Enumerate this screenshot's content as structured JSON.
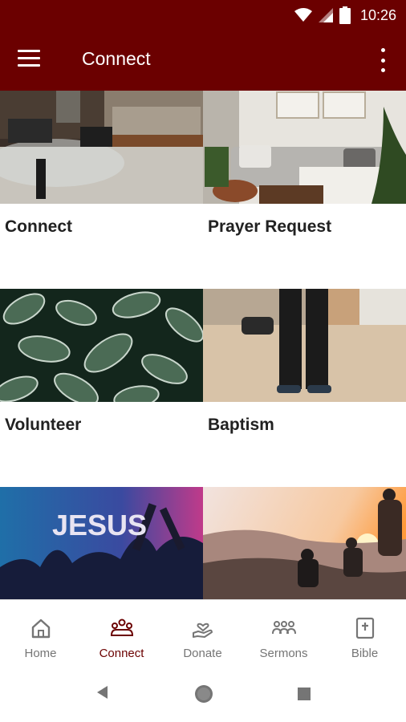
{
  "status_bar": {
    "time": "10:26"
  },
  "app_bar": {
    "title": "Connect"
  },
  "tiles": [
    {
      "label": "Connect"
    },
    {
      "label": "Prayer Request"
    },
    {
      "label": "Volunteer"
    },
    {
      "label": "Baptism"
    },
    {
      "label": "JESUS"
    },
    {
      "label": ""
    }
  ],
  "bottom_nav": {
    "items": [
      {
        "label": "Home",
        "icon": "home-icon"
      },
      {
        "label": "Connect",
        "icon": "people-icon",
        "active": true
      },
      {
        "label": "Donate",
        "icon": "donate-hand-heart-icon"
      },
      {
        "label": "Sermons",
        "icon": "group-icon"
      },
      {
        "label": "Bible",
        "icon": "bible-icon"
      }
    ]
  },
  "colors": {
    "brand": "#6b0000",
    "active_nav": "#6b0000",
    "inactive_nav": "#757575"
  }
}
